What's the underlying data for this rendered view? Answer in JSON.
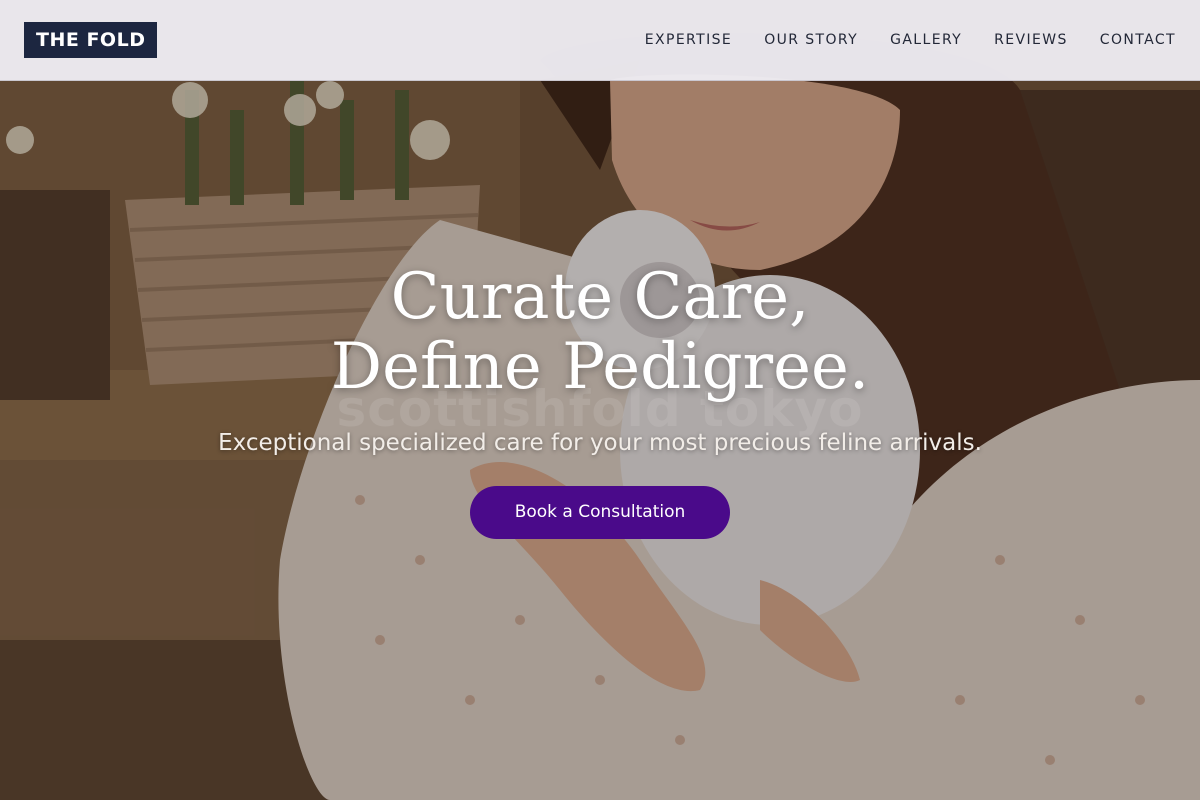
{
  "brand": {
    "logo_text": "THE FOLD"
  },
  "nav": {
    "items": [
      {
        "label": "EXPERTISE"
      },
      {
        "label": "OUR STORY"
      },
      {
        "label": "GALLERY"
      },
      {
        "label": "REVIEWS"
      },
      {
        "label": "CONTACT"
      }
    ]
  },
  "hero": {
    "title_line1": "Curate Care,",
    "title_line2": "Define Pedigree.",
    "subtitle": "Exceptional specialized care for your most precious feline arrivals.",
    "cta_label": "Book a Consultation",
    "watermark": "scottishfold tokyo",
    "image_description": "woman holding white kitten"
  },
  "colors": {
    "logo_bg": "#1c2640",
    "cta_bg": "#4a0a8a",
    "header_bg": "#eeecf2",
    "nav_text": "#232838"
  }
}
